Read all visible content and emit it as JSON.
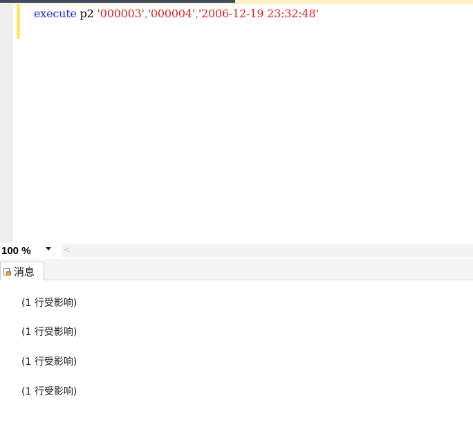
{
  "editor": {
    "code": {
      "keyword": "execute",
      "proc": " p2 ",
      "arg1": "'000003'",
      "sep1": ",",
      "arg2": "'000004'",
      "sep2": ",",
      "arg3": "'2006-12-19 23:32:48'"
    }
  },
  "zoom": {
    "value": "100 %",
    "left_arrow": "<"
  },
  "results": {
    "tabs": [
      {
        "label": "消息",
        "icon": "messages-icon",
        "active": true
      }
    ],
    "messages": [
      "(1 行受影响)",
      "(1 行受影响)",
      "(1 行受影响)",
      "(1 行受影响)"
    ]
  },
  "colors": {
    "keyword": "#1e2bd6",
    "string": "#e02020",
    "change_bar": "#ffe86b",
    "gutter": "#efefef"
  }
}
